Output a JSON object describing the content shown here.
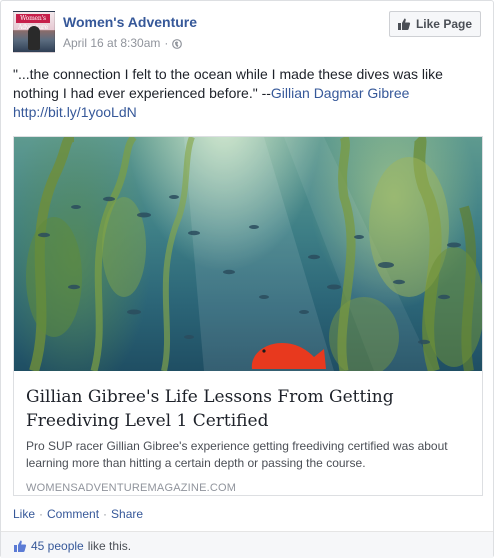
{
  "post": {
    "page_name": "Women's Adventure",
    "timestamp": "April 16 at 8:30am",
    "meta_separator": "·",
    "like_page_label": "Like Page",
    "avatar_masthead": "Women's Adventure",
    "text_quote": "\"...the connection I felt to the ocean while I made these dives was like nothing I had ever experienced before.\" --",
    "text_author": "Gillian Dagmar Gibree",
    "text_link": "http://bit.ly/1yooLdN"
  },
  "attachment": {
    "title": "Gillian Gibree's Life Lessons From Getting Freediving Level 1 Certified",
    "description": "Pro SUP racer Gillian Gibree's experience getting freediving certified was about learning more than hitting a certain depth or passing the course.",
    "domain": "WOMENSADVENTUREMAGAZINE.COM"
  },
  "actions": {
    "like": "Like",
    "comment": "Comment",
    "share": "Share",
    "separator": "·"
  },
  "footer": {
    "likes_count": "45 people",
    "likes_suffix": "like this."
  },
  "colors": {
    "link_blue": "#365899",
    "text": "#1d2129",
    "muted": "#90949c",
    "fish_orange": "#e8391e"
  },
  "icons": {
    "like_page": "thumbs-up-icon",
    "audience": "globe-icon",
    "likes_summary": "thumbs-up-icon"
  }
}
